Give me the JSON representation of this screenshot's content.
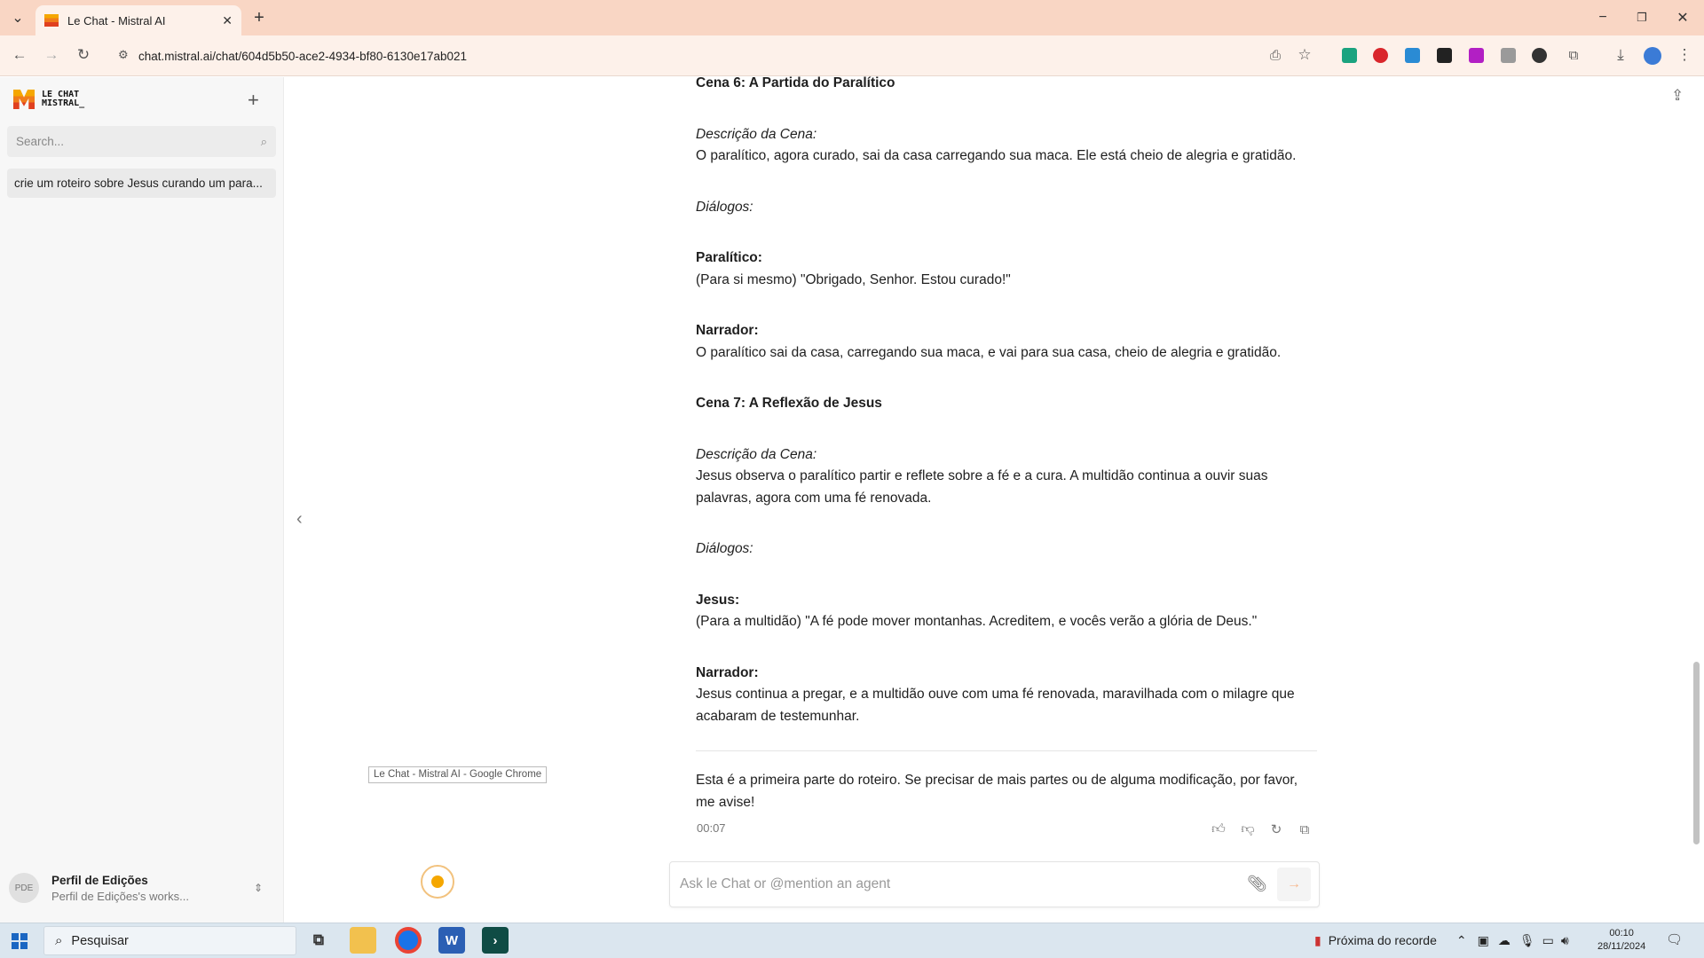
{
  "browser": {
    "tab_title": "Le Chat - Mistral AI",
    "url": "chat.mistral.ai/chat/604d5b50-ace2-4934-bf80-6130e17ab021"
  },
  "sidebar": {
    "logo_line1": "LE CHAT",
    "logo_line2": "MISTRAL_",
    "search_placeholder": "Search...",
    "conversation": "crie um roteiro sobre Jesus curando um para...",
    "profile_initials": "PDE",
    "profile_name": "Perfil de Edições",
    "profile_sub": "Perfil de Edições's works..."
  },
  "message": {
    "blocks": [
      {
        "type": "heading",
        "text": "Cena 6: A Partida do Paralítico"
      },
      {
        "type": "label_italic",
        "label": "Descrição da Cena:",
        "text": "O paralítico, agora curado, sai da casa carregando sua maca. Ele está cheio de alegria e gratidão."
      },
      {
        "type": "italic",
        "text": "Diálogos:"
      },
      {
        "type": "label_bold",
        "label": "Paralítico:",
        "text": "(Para si mesmo) \"Obrigado, Senhor. Estou curado!\""
      },
      {
        "type": "label_bold",
        "label": "Narrador:",
        "text": "O paralítico sai da casa, carregando sua maca, e vai para sua casa, cheio de alegria e gratidão."
      },
      {
        "type": "heading",
        "text": "Cena 7: A Reflexão de Jesus"
      },
      {
        "type": "label_italic",
        "label": "Descrição da Cena:",
        "text": "Jesus observa o paralítico partir e reflete sobre a fé e a cura. A multidão continua a ouvir suas palavras, agora com uma fé renovada."
      },
      {
        "type": "italic",
        "text": "Diálogos:"
      },
      {
        "type": "label_bold",
        "label": "Jesus:",
        "text": "(Para a multidão) \"A fé pode mover montanhas. Acreditem, e vocês verão a glória de Deus.\""
      },
      {
        "type": "label_bold",
        "label": "Narrador:",
        "text": "Jesus continua a pregar, e a multidão ouve com uma fé renovada, maravilhada com o milagre que acabaram de testemunhar."
      }
    ],
    "closing": "Esta é a primeira parte do roteiro. Se precisar de mais partes ou de alguma modificação, por favor, me avise!",
    "elapsed": "00:07"
  },
  "input": {
    "placeholder": "Ask le Chat or @mention an agent"
  },
  "tooltip": "Le Chat - Mistral AI - Google Chrome",
  "taskbar": {
    "search_label": "Pesquisar",
    "weather_text": "Próxima do recorde",
    "time": "00:10",
    "date": "28/11/2024"
  },
  "colors": {
    "tab_bar": "#f9d6c4",
    "address_bar": "#fdf1ea",
    "accent": "#f07c1b"
  }
}
